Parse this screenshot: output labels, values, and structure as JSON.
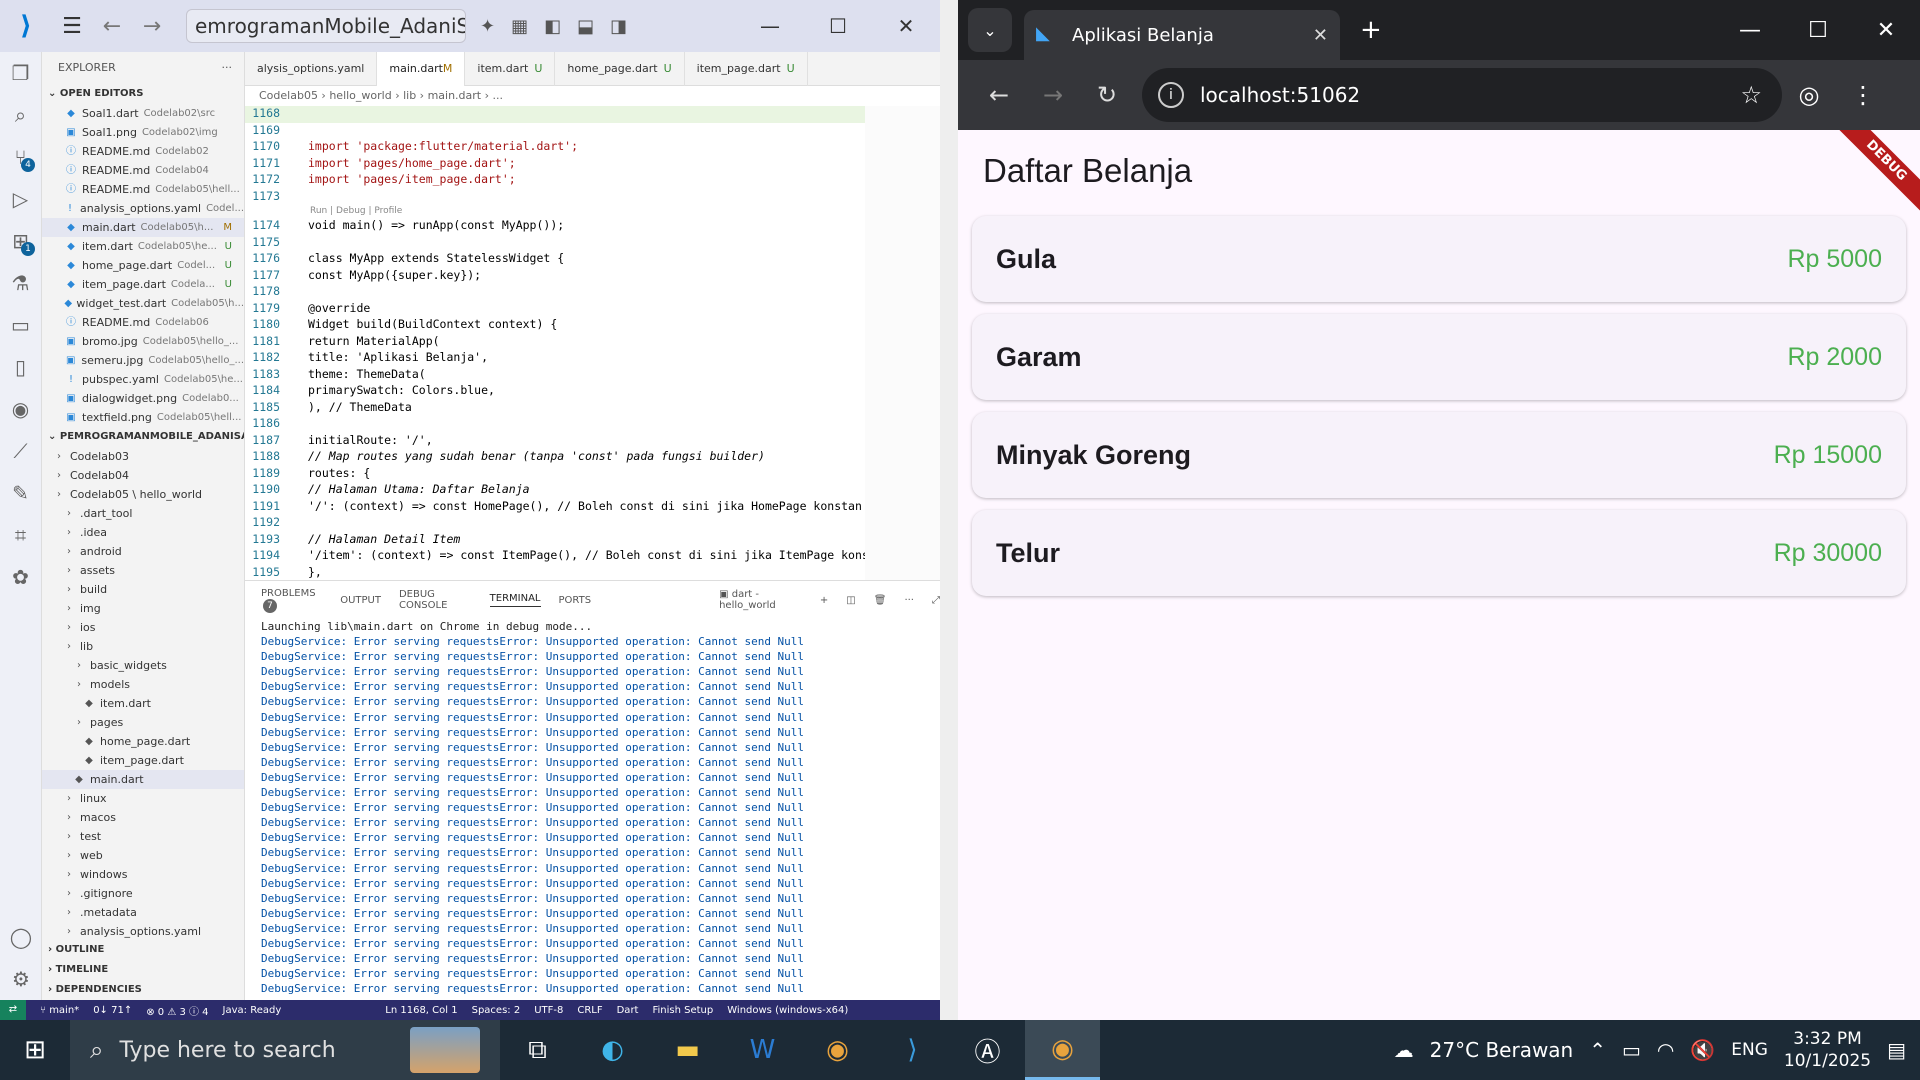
{
  "vscode": {
    "command_center": "emrogramanMobile_AdaniSalsabila",
    "explorer_title": "EXPLORER",
    "open_editors_label": "OPEN EDITORS",
    "open_editors": [
      {
        "name": "Soal1.dart",
        "path": "Codelab02\\src",
        "status": ""
      },
      {
        "name": "Soal1.png",
        "path": "Codelab02\\img",
        "status": ""
      },
      {
        "name": "README.md",
        "path": "Codelab02",
        "status": ""
      },
      {
        "name": "README.md",
        "path": "Codelab04",
        "status": ""
      },
      {
        "name": "README.md",
        "path": "Codelab05\\hell...",
        "status": ""
      },
      {
        "name": "analysis_options.yaml",
        "path": "Codel...",
        "status": ""
      },
      {
        "name": "main.dart",
        "path": "Codelab05\\h...",
        "status": "M"
      },
      {
        "name": "item.dart",
        "path": "Codelab05\\he...",
        "status": "U"
      },
      {
        "name": "home_page.dart",
        "path": "Codel...",
        "status": "U"
      },
      {
        "name": "item_page.dart",
        "path": "Codela...",
        "status": "U"
      },
      {
        "name": "widget_test.dart",
        "path": "Codelab05\\h...",
        "status": ""
      },
      {
        "name": "README.md",
        "path": "Codelab06",
        "status": ""
      },
      {
        "name": "bromo.jpg",
        "path": "Codelab05\\hello_...",
        "status": ""
      },
      {
        "name": "semeru.jpg",
        "path": "Codelab05\\hello_...",
        "status": ""
      },
      {
        "name": "pubspec.yaml",
        "path": "Codelab05\\he...",
        "status": ""
      },
      {
        "name": "dialogwidget.png",
        "path": "Codelab0...",
        "status": ""
      },
      {
        "name": "textfield.png",
        "path": "Codelab05\\hell...",
        "status": ""
      }
    ],
    "project_label": "PEMROGRAMANMOBILE_ADANISALSA...",
    "tree": [
      {
        "name": "Codelab03",
        "indent": 1
      },
      {
        "name": "Codelab04",
        "indent": 1
      },
      {
        "name": "Codelab05 \\ hello_world",
        "indent": 1
      },
      {
        "name": ".dart_tool",
        "indent": 2
      },
      {
        "name": ".idea",
        "indent": 2
      },
      {
        "name": "android",
        "indent": 2
      },
      {
        "name": "assets",
        "indent": 2
      },
      {
        "name": "build",
        "indent": 2
      },
      {
        "name": "img",
        "indent": 2
      },
      {
        "name": "ios",
        "indent": 2
      },
      {
        "name": "lib",
        "indent": 2
      },
      {
        "name": "basic_widgets",
        "indent": 3
      },
      {
        "name": "models",
        "indent": 3
      },
      {
        "name": "item.dart",
        "indent": 4
      },
      {
        "name": "pages",
        "indent": 3
      },
      {
        "name": "home_page.dart",
        "indent": 4
      },
      {
        "name": "item_page.dart",
        "indent": 4
      },
      {
        "name": "main.dart",
        "indent": 3
      },
      {
        "name": "linux",
        "indent": 2
      },
      {
        "name": "macos",
        "indent": 2
      },
      {
        "name": "test",
        "indent": 2
      },
      {
        "name": "web",
        "indent": 2
      },
      {
        "name": "windows",
        "indent": 2
      },
      {
        "name": ".gitignore",
        "indent": 2
      },
      {
        "name": ".metadata",
        "indent": 2
      },
      {
        "name": "analysis_options.yaml",
        "indent": 2
      }
    ],
    "outline_label": "OUTLINE",
    "timeline_label": "TIMELINE",
    "dependencies_label": "DEPENDENCIES",
    "tabs": [
      {
        "label": "alysis_options.yaml",
        "status": ""
      },
      {
        "label": "main.dart",
        "status": "M"
      },
      {
        "label": "item.dart",
        "status": "U"
      },
      {
        "label": "home_page.dart",
        "status": "U"
      },
      {
        "label": "item_page.dart",
        "status": "U"
      }
    ],
    "breadcrumb": "Codelab05 › hello_world › lib › main.dart › ...",
    "code": [
      {
        "n": "1168",
        "t": ""
      },
      {
        "n": "1169",
        "t": ""
      },
      {
        "n": "1170",
        "t": "import 'package:flutter/material.dart';"
      },
      {
        "n": "1171",
        "t": "import 'pages/home_page.dart';"
      },
      {
        "n": "1172",
        "t": "import 'pages/item_page.dart';"
      },
      {
        "n": "1173",
        "t": ""
      },
      {
        "n": "1174",
        "t": "void main() => runApp(const MyApp());"
      },
      {
        "n": "1175",
        "t": ""
      },
      {
        "n": "1176",
        "t": "class MyApp extends StatelessWidget {"
      },
      {
        "n": "1177",
        "t": "const MyApp({super.key});"
      },
      {
        "n": "1178",
        "t": ""
      },
      {
        "n": "1179",
        "t": " @override"
      },
      {
        "n": "1180",
        "t": " Widget build(BuildContext context) {"
      },
      {
        "n": "1181",
        "t": " return MaterialApp("
      },
      {
        "n": "1182",
        "t": "title: 'Aplikasi Belanja',"
      },
      {
        "n": "1183",
        "t": " theme: ThemeData("
      },
      {
        "n": "1184",
        "t": " primarySwatch: Colors.blue,"
      },
      {
        "n": "1185",
        "t": " ), // ThemeData"
      },
      {
        "n": "1186",
        "t": ""
      },
      {
        "n": "1187",
        "t": " initialRoute: '/',"
      },
      {
        "n": "1188",
        "t": " // Map routes yang sudah benar (tanpa 'const' pada fungsi builder)"
      },
      {
        "n": "1189",
        "t": "routes: {"
      },
      {
        "n": "1190",
        "t": " // Halaman Utama: Daftar Belanja"
      },
      {
        "n": "1191",
        "t": " '/': (context) => const HomePage(), // Boleh const di sini jika HomePage konstan"
      },
      {
        "n": "1192",
        "t": ""
      },
      {
        "n": "1193",
        "t": " // Halaman Detail Item"
      },
      {
        "n": "1194",
        "t": "'/item': (context) => const ItemPage(), // Boleh const di sini jika ItemPage konst"
      },
      {
        "n": "1195",
        "t": "},"
      }
    ],
    "codelens": "Run | Debug | Profile",
    "panel_tabs": {
      "problems": "PROBLEMS",
      "problems_count": "7",
      "output": "OUTPUT",
      "debug": "DEBUG CONSOLE",
      "terminal": "TERMINAL",
      "ports": "PORTS",
      "shell": "dart - hello_world"
    },
    "terminal_first": "Launching lib\\main.dart on Chrome in debug mode...",
    "terminal_error": "DebugService: Error serving requestsError: Unsupported operation: Cannot send Null",
    "terminal_error_count": 24,
    "status": {
      "branch": "main*",
      "sync": "0↓ 71↑",
      "problems": "⊗ 0 ⚠ 3 ⓘ 4",
      "java": "Java: Ready",
      "position": "Ln 1168, Col 1",
      "spaces": "Spaces: 2",
      "encoding": "UTF-8",
      "eol": "CRLF",
      "language": "Dart",
      "finish": "Finish Setup",
      "device": "Windows (windows-x64)"
    }
  },
  "chrome": {
    "tab_title": "Aplikasi Belanja",
    "url": "localhost:51062",
    "app_title": "Daftar Belanja",
    "debug_banner": "DEBUG",
    "items": [
      {
        "name": "Gula",
        "price": "Rp 5000"
      },
      {
        "name": "Garam",
        "price": "Rp 2000"
      },
      {
        "name": "Minyak Goreng",
        "price": "Rp 15000"
      },
      {
        "name": "Telur",
        "price": "Rp 30000"
      }
    ],
    "price_color": "#4caf50"
  },
  "taskbar": {
    "search_placeholder": "Type here to search",
    "weather": "27°C  Berawan",
    "language": "ENG",
    "time": "3:32 PM",
    "date": "10/1/2025",
    "notif_count": "1"
  }
}
